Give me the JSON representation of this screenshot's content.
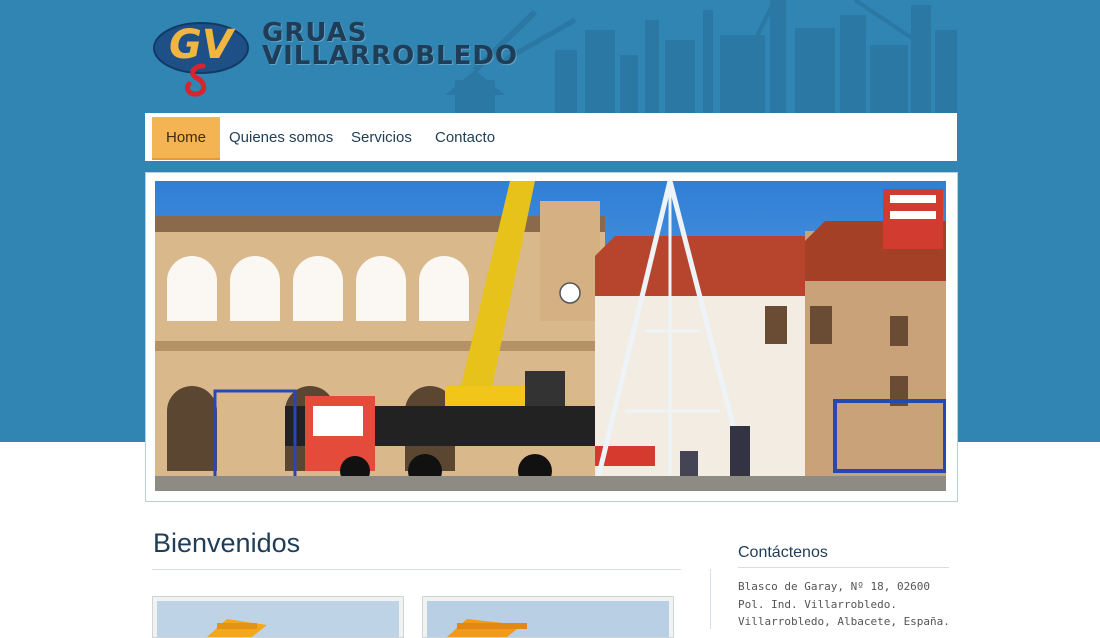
{
  "brand": {
    "line1": "GRUAS",
    "line2": "VILLARROBLEDO",
    "monogram": "GV"
  },
  "nav": {
    "items": [
      {
        "label": "Home",
        "active": true
      },
      {
        "label": "Quienes somos",
        "active": false
      },
      {
        "label": "Servicios",
        "active": false
      },
      {
        "label": "Contacto",
        "active": false
      }
    ]
  },
  "slider": {
    "image": "town-square-crane-christmas-tree-photo"
  },
  "main": {
    "heading": "Bienvenidos"
  },
  "sidebar": {
    "title": "Contáctenos",
    "address": [
      "Blasco de Garay, Nº 18, 02600",
      "Pol. Ind. Villarrobledo.",
      "Villarrobledo, Albacete, España."
    ]
  },
  "colors": {
    "header_blue": "#3085b2",
    "nav_active": "#f4b453",
    "text_dark": "#1f3d57"
  }
}
